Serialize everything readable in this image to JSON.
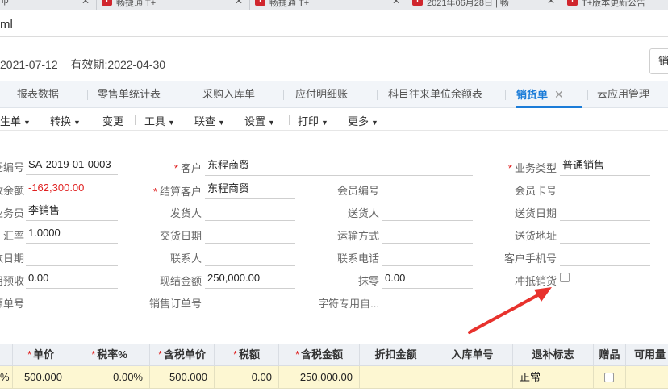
{
  "browser_tabs": [
    {
      "label": "ip",
      "favicon": false
    },
    {
      "label": "畅捷通 T+",
      "favicon": true
    },
    {
      "label": "畅捷通 T+",
      "favicon": true
    },
    {
      "label": "2021年06月28日 | 畅",
      "favicon": true
    },
    {
      "label": "T+版本更新公告",
      "favicon": true
    }
  ],
  "address": "ml",
  "info": {
    "date": "2021-07-12",
    "validity": "有效期:2022-04-30",
    "top_button": "销"
  },
  "module_tabs": [
    "报表数据",
    "零售单统计表",
    "采购入库单",
    "应付明细账",
    "科目往来单位余额表",
    "销货单",
    "云应用管理"
  ],
  "module_tab_close": "✕",
  "toolbar": [
    {
      "label": "生单",
      "dropdown": true
    },
    {
      "label": "转换",
      "dropdown": true
    },
    {
      "label": "变更",
      "dropdown": false
    },
    {
      "label": "工具",
      "dropdown": true
    },
    {
      "label": "联查",
      "dropdown": true
    },
    {
      "label": "设置",
      "dropdown": true
    },
    {
      "label": "打印",
      "dropdown": true
    },
    {
      "label": "更多",
      "dropdown": true
    }
  ],
  "form": {
    "col1": [
      {
        "label": "据编号",
        "value": "SA-2019-01-0003"
      },
      {
        "label": "收余额",
        "value": "-162,300.00"
      },
      {
        "label": "业务员",
        "value": "李销售"
      },
      {
        "label": "汇率",
        "value": "1.0000"
      },
      {
        "label": "款日期",
        "value": ""
      },
      {
        "label": "用预收",
        "value": "0.00"
      },
      {
        "label": "源单号",
        "value": ""
      }
    ],
    "col2": [
      {
        "label": "客户",
        "value": "东程商贸",
        "required": true
      },
      {
        "label": "结算客户",
        "value": "东程商贸",
        "required": true
      },
      {
        "label": "发货人",
        "value": ""
      },
      {
        "label": "交货日期",
        "value": ""
      },
      {
        "label": "联系人",
        "value": ""
      },
      {
        "label": "现结金额",
        "value": "250,000.00"
      },
      {
        "label": "销售订单号",
        "value": ""
      }
    ],
    "col3": [
      {
        "label": "会员编号",
        "value": ""
      },
      {
        "label": "送货人",
        "value": ""
      },
      {
        "label": "运输方式",
        "value": ""
      },
      {
        "label": "联系电话",
        "value": ""
      },
      {
        "label": "抹零",
        "value": "0.00"
      },
      {
        "label": "字符专用自...",
        "value": ""
      }
    ],
    "col4": [
      {
        "label": "业务类型",
        "value": "普通销售",
        "required": true
      },
      {
        "label": "会员卡号",
        "value": ""
      },
      {
        "label": "送货日期",
        "value": ""
      },
      {
        "label": "送货地址",
        "value": ""
      },
      {
        "label": "客户手机号",
        "value": ""
      },
      {
        "label": "冲抵销货",
        "checked": false
      }
    ]
  },
  "grid": {
    "columns": [
      {
        "label": "",
        "required": false
      },
      {
        "label": "单价",
        "required": true
      },
      {
        "label": "税率%",
        "required": true
      },
      {
        "label": "含税单价",
        "required": true
      },
      {
        "label": "税额",
        "required": true
      },
      {
        "label": "含税金额",
        "required": true
      },
      {
        "label": "折扣金额",
        "required": false
      },
      {
        "label": "入库单号",
        "required": false
      },
      {
        "label": "退补标志",
        "required": false
      },
      {
        "label": "赠品",
        "required": false
      },
      {
        "label": "可用量",
        "required": false
      }
    ],
    "row": [
      "%",
      "500.000",
      "0.00%",
      "500.000",
      "0.00",
      "250,000.00",
      "",
      "",
      "正常",
      "",
      ""
    ],
    "gift_checked": false
  },
  "colors": {
    "accent": "#1b7cd8",
    "required": "#e02020",
    "arrow": "#e8322d",
    "row_bg": "#fdf7d2",
    "tab_bg": "#f2f5f9"
  }
}
